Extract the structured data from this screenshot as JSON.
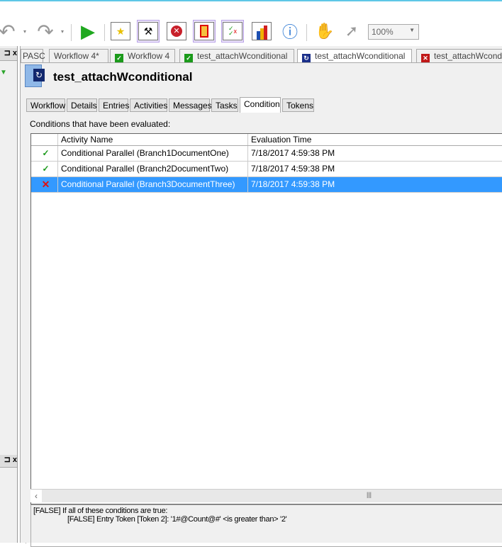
{
  "toolbar": {
    "zoom_value": "100%",
    "icons": [
      "undo-icon",
      "redo-icon",
      "run-icon",
      "find-icon",
      "tools-icon",
      "stop-icon",
      "layout-icon",
      "checklist-icon",
      "chart-icon",
      "info-icon",
      "hand-icon",
      "pointer-icon"
    ]
  },
  "doc_tabs": [
    {
      "label": "PASC",
      "status": "none"
    },
    {
      "label": "Workflow 4*",
      "status": "none"
    },
    {
      "label": "Workflow 4",
      "status": "success"
    },
    {
      "label": "test_attachWconditional",
      "status": "success"
    },
    {
      "label": "test_attachWconditional",
      "status": "running",
      "active": true
    },
    {
      "label": "test_attachWcond",
      "status": "error"
    }
  ],
  "header": {
    "title": "test_attachWconditional"
  },
  "tabs": [
    "Workflow",
    "Details",
    "Entries",
    "Activities",
    "Messages",
    "Tasks",
    "Condition",
    "Tokens"
  ],
  "active_tab": "Condition",
  "condition": {
    "label": "Conditions that have been evaluated:",
    "columns": [
      "Activity Name",
      "Evaluation Time"
    ],
    "rows": [
      {
        "status": "true",
        "activity": "Conditional Parallel (Branch1DocumentOne)",
        "time": "7/18/2017 4:59:38 PM"
      },
      {
        "status": "true",
        "activity": "Conditional Parallel (Branch2DocumentTwo)",
        "time": "7/18/2017 4:59:38 PM"
      },
      {
        "status": "false",
        "activity": "Conditional Parallel (Branch3DocumentThree)",
        "time": "7/18/2017 4:59:38 PM",
        "selected": true
      }
    ],
    "details": {
      "line1": "[FALSE] If all of these conditions are true:",
      "line2": "[FALSE] Entry Token [Token 2]:  '1#@Count@#' <is greater than> '2'"
    }
  },
  "colors": {
    "selection": "#3399ff",
    "success": "#1a9a1a",
    "error": "#e01010"
  }
}
